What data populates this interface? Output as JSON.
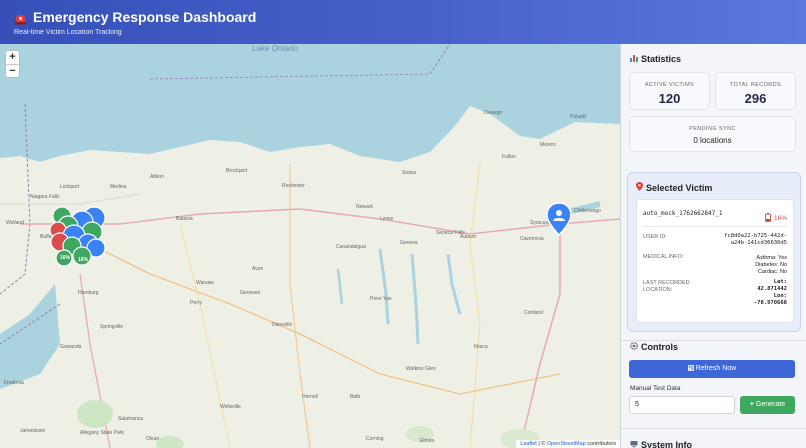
{
  "header": {
    "title": "Emergency Response Dashboard",
    "subtitle": "Real-time Victim Location Tracking",
    "icon": "siren-icon"
  },
  "map": {
    "zoom_in": "+",
    "zoom_out": "−",
    "lake_label": "Lake Ontario",
    "places": [
      "Oswego",
      "Syracuse",
      "Rochester",
      "Buffalo",
      "Ithaca",
      "Cortland",
      "Geneva",
      "Batavia",
      "Lockport",
      "Niagara Falls",
      "Welland",
      "Canandaigua",
      "Auburn",
      "Brockport",
      "Albion",
      "Medina",
      "Olean",
      "Hornell",
      "Corning",
      "Elmira",
      "Dansville",
      "Avon",
      "Chittenango",
      "Fulton",
      "Watkins Glen",
      "Lyons",
      "Geneseo",
      "Warsaw",
      "Wellsville",
      "Salamanca",
      "Jamestown",
      "Allegany State Park",
      "Springville",
      "Gowanda",
      "Fredonia",
      "Hamburg",
      "Cazenovia",
      "Perry",
      "Bath",
      "Penn Yan",
      "Seneca Falls",
      "Newark",
      "Sodus",
      "Pulaski",
      "Mexico"
    ],
    "attribution_leaflet": "Leaflet",
    "attribution_sep": " | © ",
    "attribution_osm": "OpenStreetMap",
    "attribution_tail": " contributors",
    "cluster_labels": [
      "16%",
      "16%"
    ],
    "colors": {
      "water": "#aad3df",
      "land": "#eef0e6",
      "marker_blue": "#3b82f6",
      "marker_green": "#3ea861",
      "marker_red": "#d94c4c"
    }
  },
  "stats": {
    "title": "Statistics",
    "icon": "bar-chart-icon",
    "active_label": "ACTIVE VICTIMS",
    "active_value": "120",
    "total_label": "TOTAL RECORDS",
    "total_value": "296",
    "pending_label": "PENDING SYNC",
    "pending_value": "0 locations"
  },
  "selected": {
    "title": "Selected Victim",
    "icon": "pin-icon",
    "victim_id": "auto_mock_1762662847_1",
    "battery": "16%",
    "user_id_label": "USER ID:",
    "user_id_line1": "fc8d0a22-b725-442d-",
    "user_id_line2": "a24b-141cd36630d5",
    "medical_label": "MEDICAL INFO:",
    "medical_lines": [
      "Asthma: Yes",
      "Diabetes: No",
      "Cardiac: No"
    ],
    "location_label_1": "LAST RECORDED",
    "location_label_2": "LOCATION:",
    "lat_label": "Lat:",
    "lat_value": "42.871442",
    "lon_label": "Lon:",
    "lon_value": "-78.970668"
  },
  "controls": {
    "title": "Controls",
    "icon": "gear-icon",
    "refresh_label": "Refresh Now",
    "manual_label": "Manual Test Data",
    "count_value": "5",
    "generate_label": "Generate"
  },
  "system": {
    "title": "System Info"
  }
}
